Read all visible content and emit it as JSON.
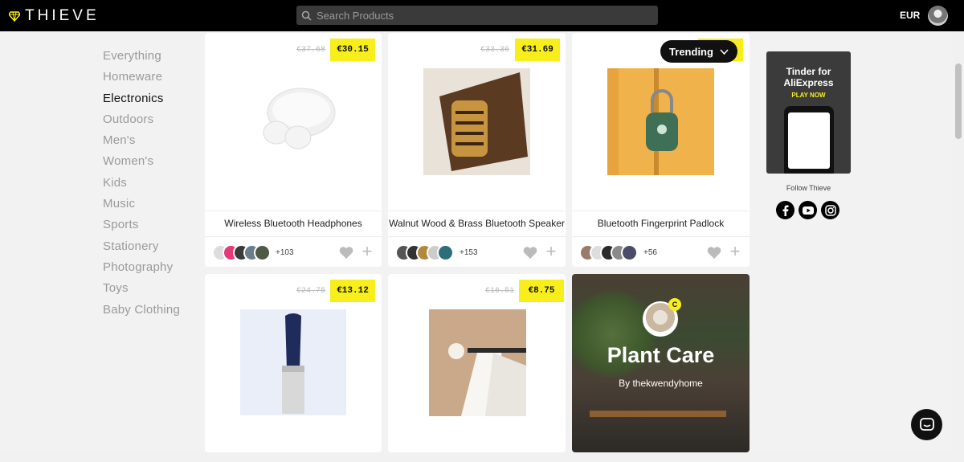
{
  "header": {
    "logo_text": "THIEVE",
    "search_placeholder": "Search Products",
    "currency": "EUR"
  },
  "sidebar": {
    "categories": [
      {
        "label": "Everything",
        "active": false
      },
      {
        "label": "Homeware",
        "active": false
      },
      {
        "label": "Electronics",
        "active": true
      },
      {
        "label": "Outdoors",
        "active": false
      },
      {
        "label": "Men's",
        "active": false
      },
      {
        "label": "Women's",
        "active": false
      },
      {
        "label": "Kids",
        "active": false
      },
      {
        "label": "Music",
        "active": false
      },
      {
        "label": "Sports",
        "active": false
      },
      {
        "label": "Stationery",
        "active": false
      },
      {
        "label": "Photography",
        "active": false
      },
      {
        "label": "Toys",
        "active": false
      },
      {
        "label": "Baby Clothing",
        "active": false
      }
    ]
  },
  "sort": {
    "label": "Trending"
  },
  "products": [
    {
      "title": "Wireless Bluetooth Headphones",
      "old_price": "€37.68",
      "price": "€30.15",
      "likes_more": "+103"
    },
    {
      "title": "Walnut Wood & Brass Bluetooth Speaker",
      "old_price": "€33.36",
      "price": "€31.69",
      "likes_more": "+153"
    },
    {
      "title": "Bluetooth Fingerprint Padlock",
      "old_price": "",
      "price": "",
      "likes_more": "+56"
    },
    {
      "title": "",
      "old_price": "€24.75",
      "price": "€13.12",
      "likes_more": ""
    },
    {
      "title": "",
      "old_price": "€16.51",
      "price": "€8.75",
      "likes_more": ""
    }
  ],
  "collection": {
    "title": "Plant Care",
    "by": "By thekwendyhome",
    "badge": "C"
  },
  "ad": {
    "title_line1": "Tinder for",
    "title_line2": "AliExpress",
    "cta": "PLAY NOW"
  },
  "follow": {
    "label": "Follow Thieve",
    "networks": [
      "facebook-icon",
      "youtube-icon",
      "instagram-icon"
    ]
  },
  "colors": {
    "accent": "#f8ee1c",
    "topbar": "#000000"
  }
}
